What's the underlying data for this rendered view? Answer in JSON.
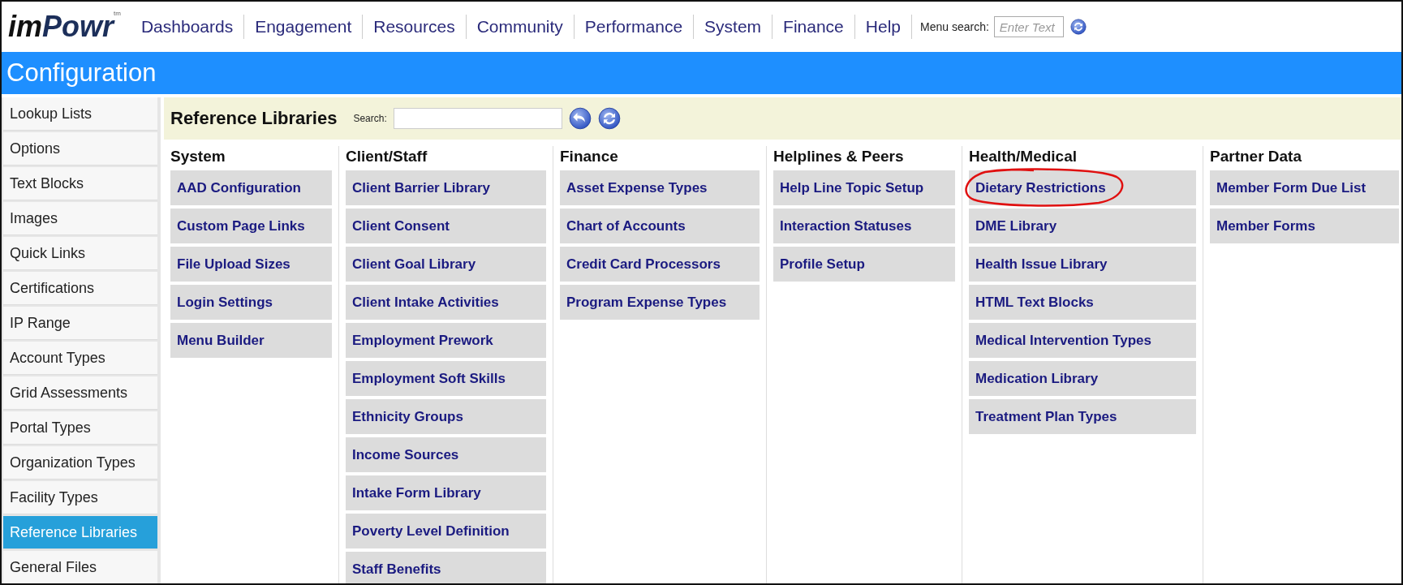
{
  "logo": {
    "parts": [
      "im",
      "Powr"
    ],
    "mark": "tm"
  },
  "menu": [
    "Dashboards",
    "Engagement",
    "Resources",
    "Community",
    "Performance",
    "System",
    "Finance",
    "Help"
  ],
  "menu_search": {
    "label": "Menu search:",
    "placeholder": "Enter Text"
  },
  "title": "Configuration",
  "sidebar": {
    "items": [
      {
        "label": "Lookup Lists",
        "selected": false
      },
      {
        "label": "Options",
        "selected": false
      },
      {
        "label": "Text Blocks",
        "selected": false
      },
      {
        "label": "Images",
        "selected": false
      },
      {
        "label": "Quick Links",
        "selected": false
      },
      {
        "label": "Certifications",
        "selected": false
      },
      {
        "label": "IP Range",
        "selected": false
      },
      {
        "label": "Account Types",
        "selected": false
      },
      {
        "label": "Grid Assessments",
        "selected": false
      },
      {
        "label": "Portal Types",
        "selected": false
      },
      {
        "label": "Organization Types",
        "selected": false
      },
      {
        "label": "Facility Types",
        "selected": false
      },
      {
        "label": "Reference Libraries",
        "selected": true
      },
      {
        "label": "General Files",
        "selected": false
      }
    ]
  },
  "panel": {
    "title": "Reference Libraries",
    "search_label": "Search:"
  },
  "columns": [
    {
      "heading": "System",
      "items": [
        {
          "label": "AAD Configuration",
          "circled": false
        },
        {
          "label": "Custom Page Links",
          "circled": false
        },
        {
          "label": "File Upload Sizes",
          "circled": false
        },
        {
          "label": "Login Settings",
          "circled": false
        },
        {
          "label": "Menu Builder",
          "circled": false
        }
      ]
    },
    {
      "heading": "Client/Staff",
      "items": [
        {
          "label": "Client Barrier Library",
          "circled": false
        },
        {
          "label": "Client Consent",
          "circled": false
        },
        {
          "label": "Client Goal Library",
          "circled": false
        },
        {
          "label": "Client Intake Activities",
          "circled": false
        },
        {
          "label": "Employment Prework",
          "circled": false
        },
        {
          "label": "Employment Soft Skills",
          "circled": false
        },
        {
          "label": "Ethnicity Groups",
          "circled": false
        },
        {
          "label": "Income Sources",
          "circled": false
        },
        {
          "label": "Intake Form Library",
          "circled": false
        },
        {
          "label": "Poverty Level Definition",
          "circled": false
        },
        {
          "label": "Staff Benefits",
          "circled": false
        }
      ]
    },
    {
      "heading": "Finance",
      "items": [
        {
          "label": "Asset Expense Types",
          "circled": false
        },
        {
          "label": "Chart of Accounts",
          "circled": false
        },
        {
          "label": "Credit Card Processors",
          "circled": false
        },
        {
          "label": "Program Expense Types",
          "circled": false
        }
      ]
    },
    {
      "heading": "Helplines & Peers",
      "items": [
        {
          "label": "Help Line Topic Setup",
          "circled": false
        },
        {
          "label": "Interaction Statuses",
          "circled": false
        },
        {
          "label": "Profile Setup",
          "circled": false
        }
      ]
    },
    {
      "heading": "Health/Medical",
      "items": [
        {
          "label": "Dietary Restrictions",
          "circled": true
        },
        {
          "label": "DME Library",
          "circled": false
        },
        {
          "label": "Health Issue Library",
          "circled": false
        },
        {
          "label": "HTML Text Blocks",
          "circled": false
        },
        {
          "label": "Medical Intervention Types",
          "circled": false
        },
        {
          "label": "Medication Library",
          "circled": false
        },
        {
          "label": "Treatment Plan Types",
          "circled": false
        }
      ]
    },
    {
      "heading": "Partner Data",
      "items": [
        {
          "label": "Member Form Due List",
          "circled": false
        },
        {
          "label": "Member Forms",
          "circled": false
        }
      ]
    }
  ]
}
